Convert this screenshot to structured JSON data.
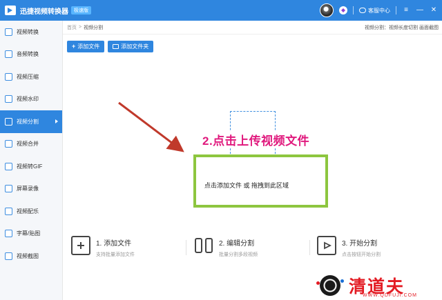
{
  "app": {
    "title": "迅捷视频转换器",
    "edition": "极速版",
    "service": "客服中心"
  },
  "window_controls": {
    "menu": "≡",
    "minimize": "—",
    "close": "✕"
  },
  "sidebar": {
    "items": [
      {
        "label": "视频转换",
        "icon": "video-convert-icon",
        "active": false
      },
      {
        "label": "音频转换",
        "icon": "audio-convert-icon",
        "active": false
      },
      {
        "label": "视频压缩",
        "icon": "video-compress-icon",
        "active": false
      },
      {
        "label": "视频水印",
        "icon": "video-watermark-icon",
        "active": false
      },
      {
        "label": "视频分割",
        "icon": "video-split-icon",
        "active": true
      },
      {
        "label": "视频合并",
        "icon": "video-merge-icon",
        "active": false
      },
      {
        "label": "视频转GIF",
        "icon": "video-gif-icon",
        "active": false
      },
      {
        "label": "屏幕录像",
        "icon": "screen-record-icon",
        "active": false
      },
      {
        "label": "视频配乐",
        "icon": "video-music-icon",
        "active": false
      },
      {
        "label": "字幕/贴图",
        "icon": "subtitle-icon",
        "active": false
      },
      {
        "label": "视频截图",
        "icon": "video-screenshot-icon",
        "active": false
      }
    ]
  },
  "breadcrumb": {
    "home": "首页",
    "separator": ">",
    "current": "视频分割"
  },
  "info_text": "视频分割：视频长度切割 画面截图",
  "toolbar": {
    "add_file": "添加文件",
    "add_folder": "添加文件夹"
  },
  "annotation": "2.点击上传视频文件",
  "drop_zone": {
    "text": "点击添加文件 或 拖拽到此区域"
  },
  "steps": [
    {
      "title": "1. 添加文件",
      "desc": "支持批量添加文件"
    },
    {
      "title": "2. 编辑分割",
      "desc": "批量分割多段视频"
    },
    {
      "title": "3. 开始分割",
      "desc": "点击按钮开始分割"
    }
  ],
  "watermark": {
    "brand": "清道夫",
    "url": "WWW.QDFUJI.COM"
  },
  "colors": {
    "primary": "#2f86df",
    "highlight_border": "#8dc63f",
    "annotation": "#e0197d",
    "arrow": "#c0392b",
    "watermark": "#e31b23"
  }
}
